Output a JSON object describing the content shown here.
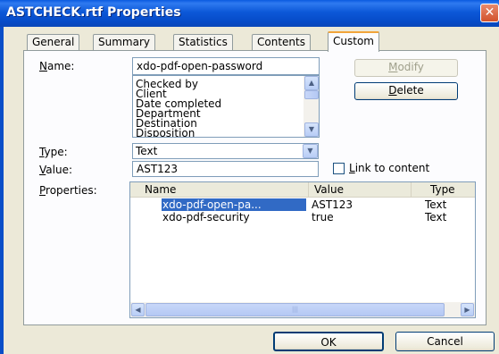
{
  "window": {
    "title": "ASTCHECK.rtf Properties",
    "close_glyph": "✕"
  },
  "tabs": [
    {
      "label": "General"
    },
    {
      "label": "Summary"
    },
    {
      "label": "Statistics"
    },
    {
      "label": "Contents"
    },
    {
      "label": "Custom",
      "active": true
    }
  ],
  "custom": {
    "name_label": "Name:",
    "name_value": "xdo-pdf-open-password",
    "name_options": [
      "Checked by",
      "Client",
      "Date completed",
      "Department",
      "Destination",
      "Disposition"
    ],
    "type_label": "Type:",
    "type_value": "Text",
    "value_label": "Value:",
    "value_value": "AST123",
    "link_label": "Link to content",
    "link_checked": false,
    "modify_label": "Modify",
    "delete_label": "Delete",
    "properties_label": "Properties:",
    "columns": [
      "Name",
      "Value",
      "Type"
    ],
    "rows": [
      {
        "name": "xdo-pdf-open-pa...",
        "value": "AST123",
        "type": "Text",
        "selected": true
      },
      {
        "name": "xdo-pdf-security",
        "value": "true",
        "type": "Text",
        "selected": false
      }
    ]
  },
  "footer": {
    "ok_label": "OK",
    "cancel_label": "Cancel"
  },
  "icons": {
    "scroll_up": "▲",
    "scroll_down": "▼",
    "scroll_left": "◀",
    "scroll_right": "▶",
    "dropdown": "▼",
    "scroll_grip": "|||"
  },
  "colors": {
    "titlebar": "#0a5ae0",
    "selection": "#316ac5",
    "active_tab_accent": "#f1a43a",
    "dialog_bg": "#ece9d8"
  }
}
